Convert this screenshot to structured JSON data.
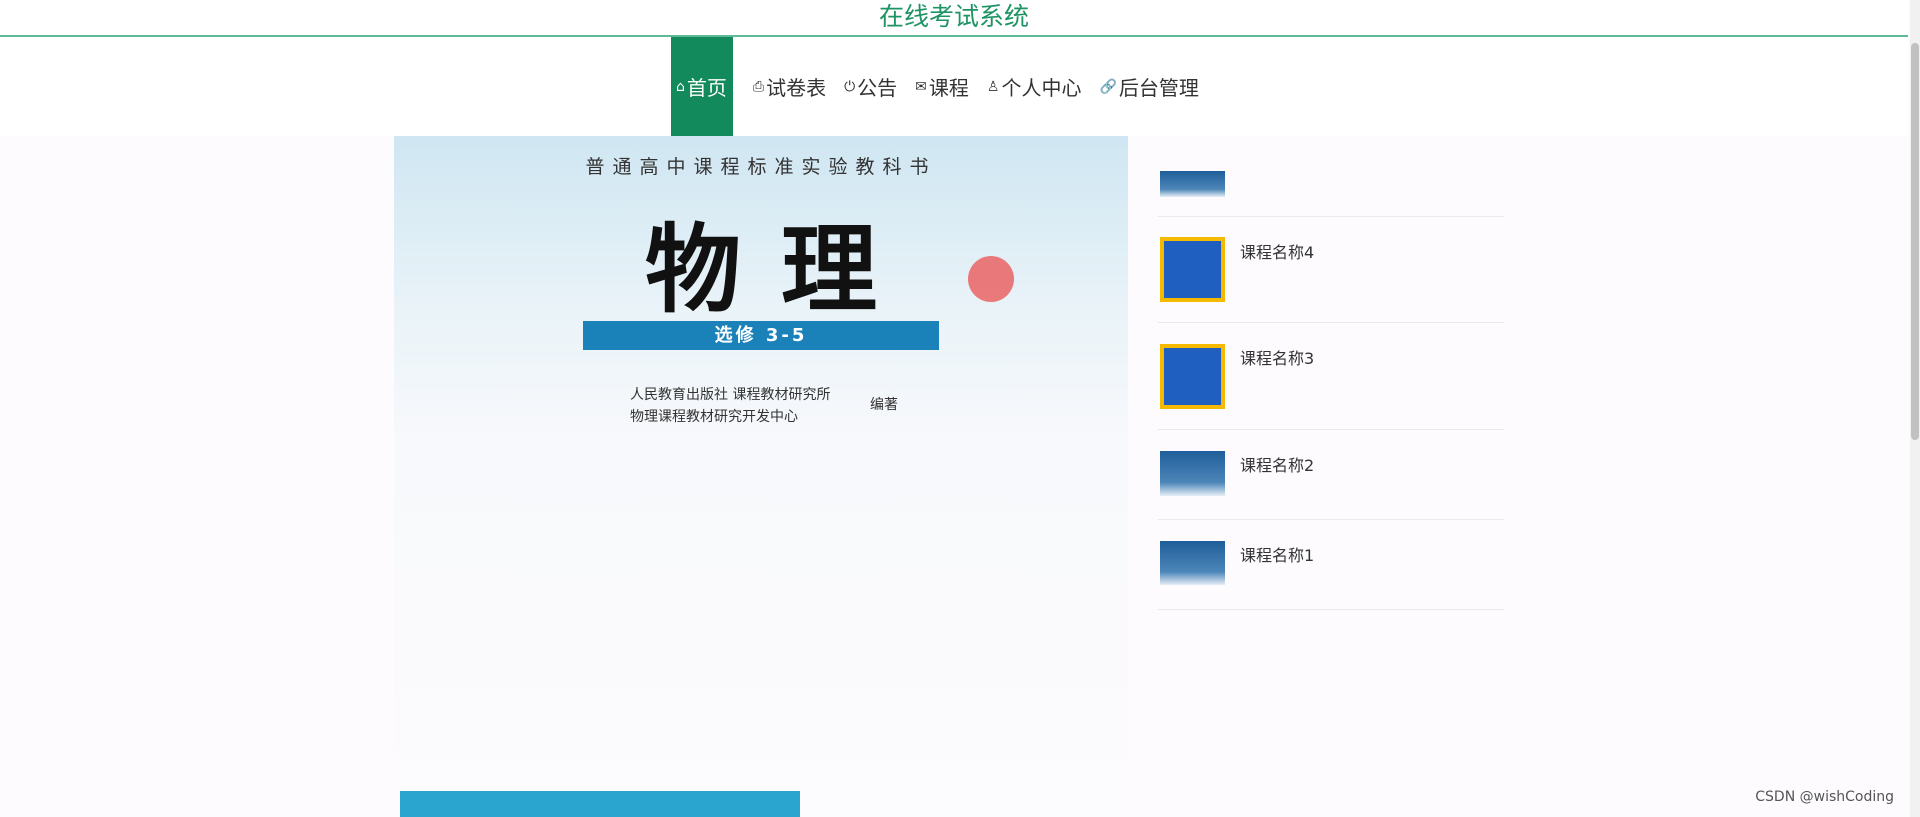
{
  "header": {
    "title": "在线考试系统"
  },
  "nav": [
    {
      "label": "首页",
      "icon": "home-icon",
      "glyph": "⌂",
      "active": true
    },
    {
      "label": "试卷表",
      "icon": "printer-icon",
      "glyph": "⎙"
    },
    {
      "label": "公告",
      "icon": "power-icon",
      "glyph": "⏻"
    },
    {
      "label": "课程",
      "icon": "envelope-icon",
      "glyph": "✉"
    },
    {
      "label": "个人中心",
      "icon": "user-icon",
      "glyph": "♙"
    },
    {
      "label": "后台管理",
      "icon": "link-icon",
      "glyph": "🔗"
    }
  ],
  "book": {
    "series": "普通高中课程标准实验教科书",
    "title": "物理",
    "volume": "选修 3-5",
    "publisher1": "人民教育出版社  课程教材研究所",
    "publisher2": "物理课程教材研究开发中心",
    "role": "编著"
  },
  "courses": [
    {
      "name": ""
    },
    {
      "name": "课程名称4"
    },
    {
      "name": "课程名称3"
    },
    {
      "name": "课程名称2"
    },
    {
      "name": "课程名称1"
    }
  ],
  "watermark": "CSDN @wishCoding"
}
